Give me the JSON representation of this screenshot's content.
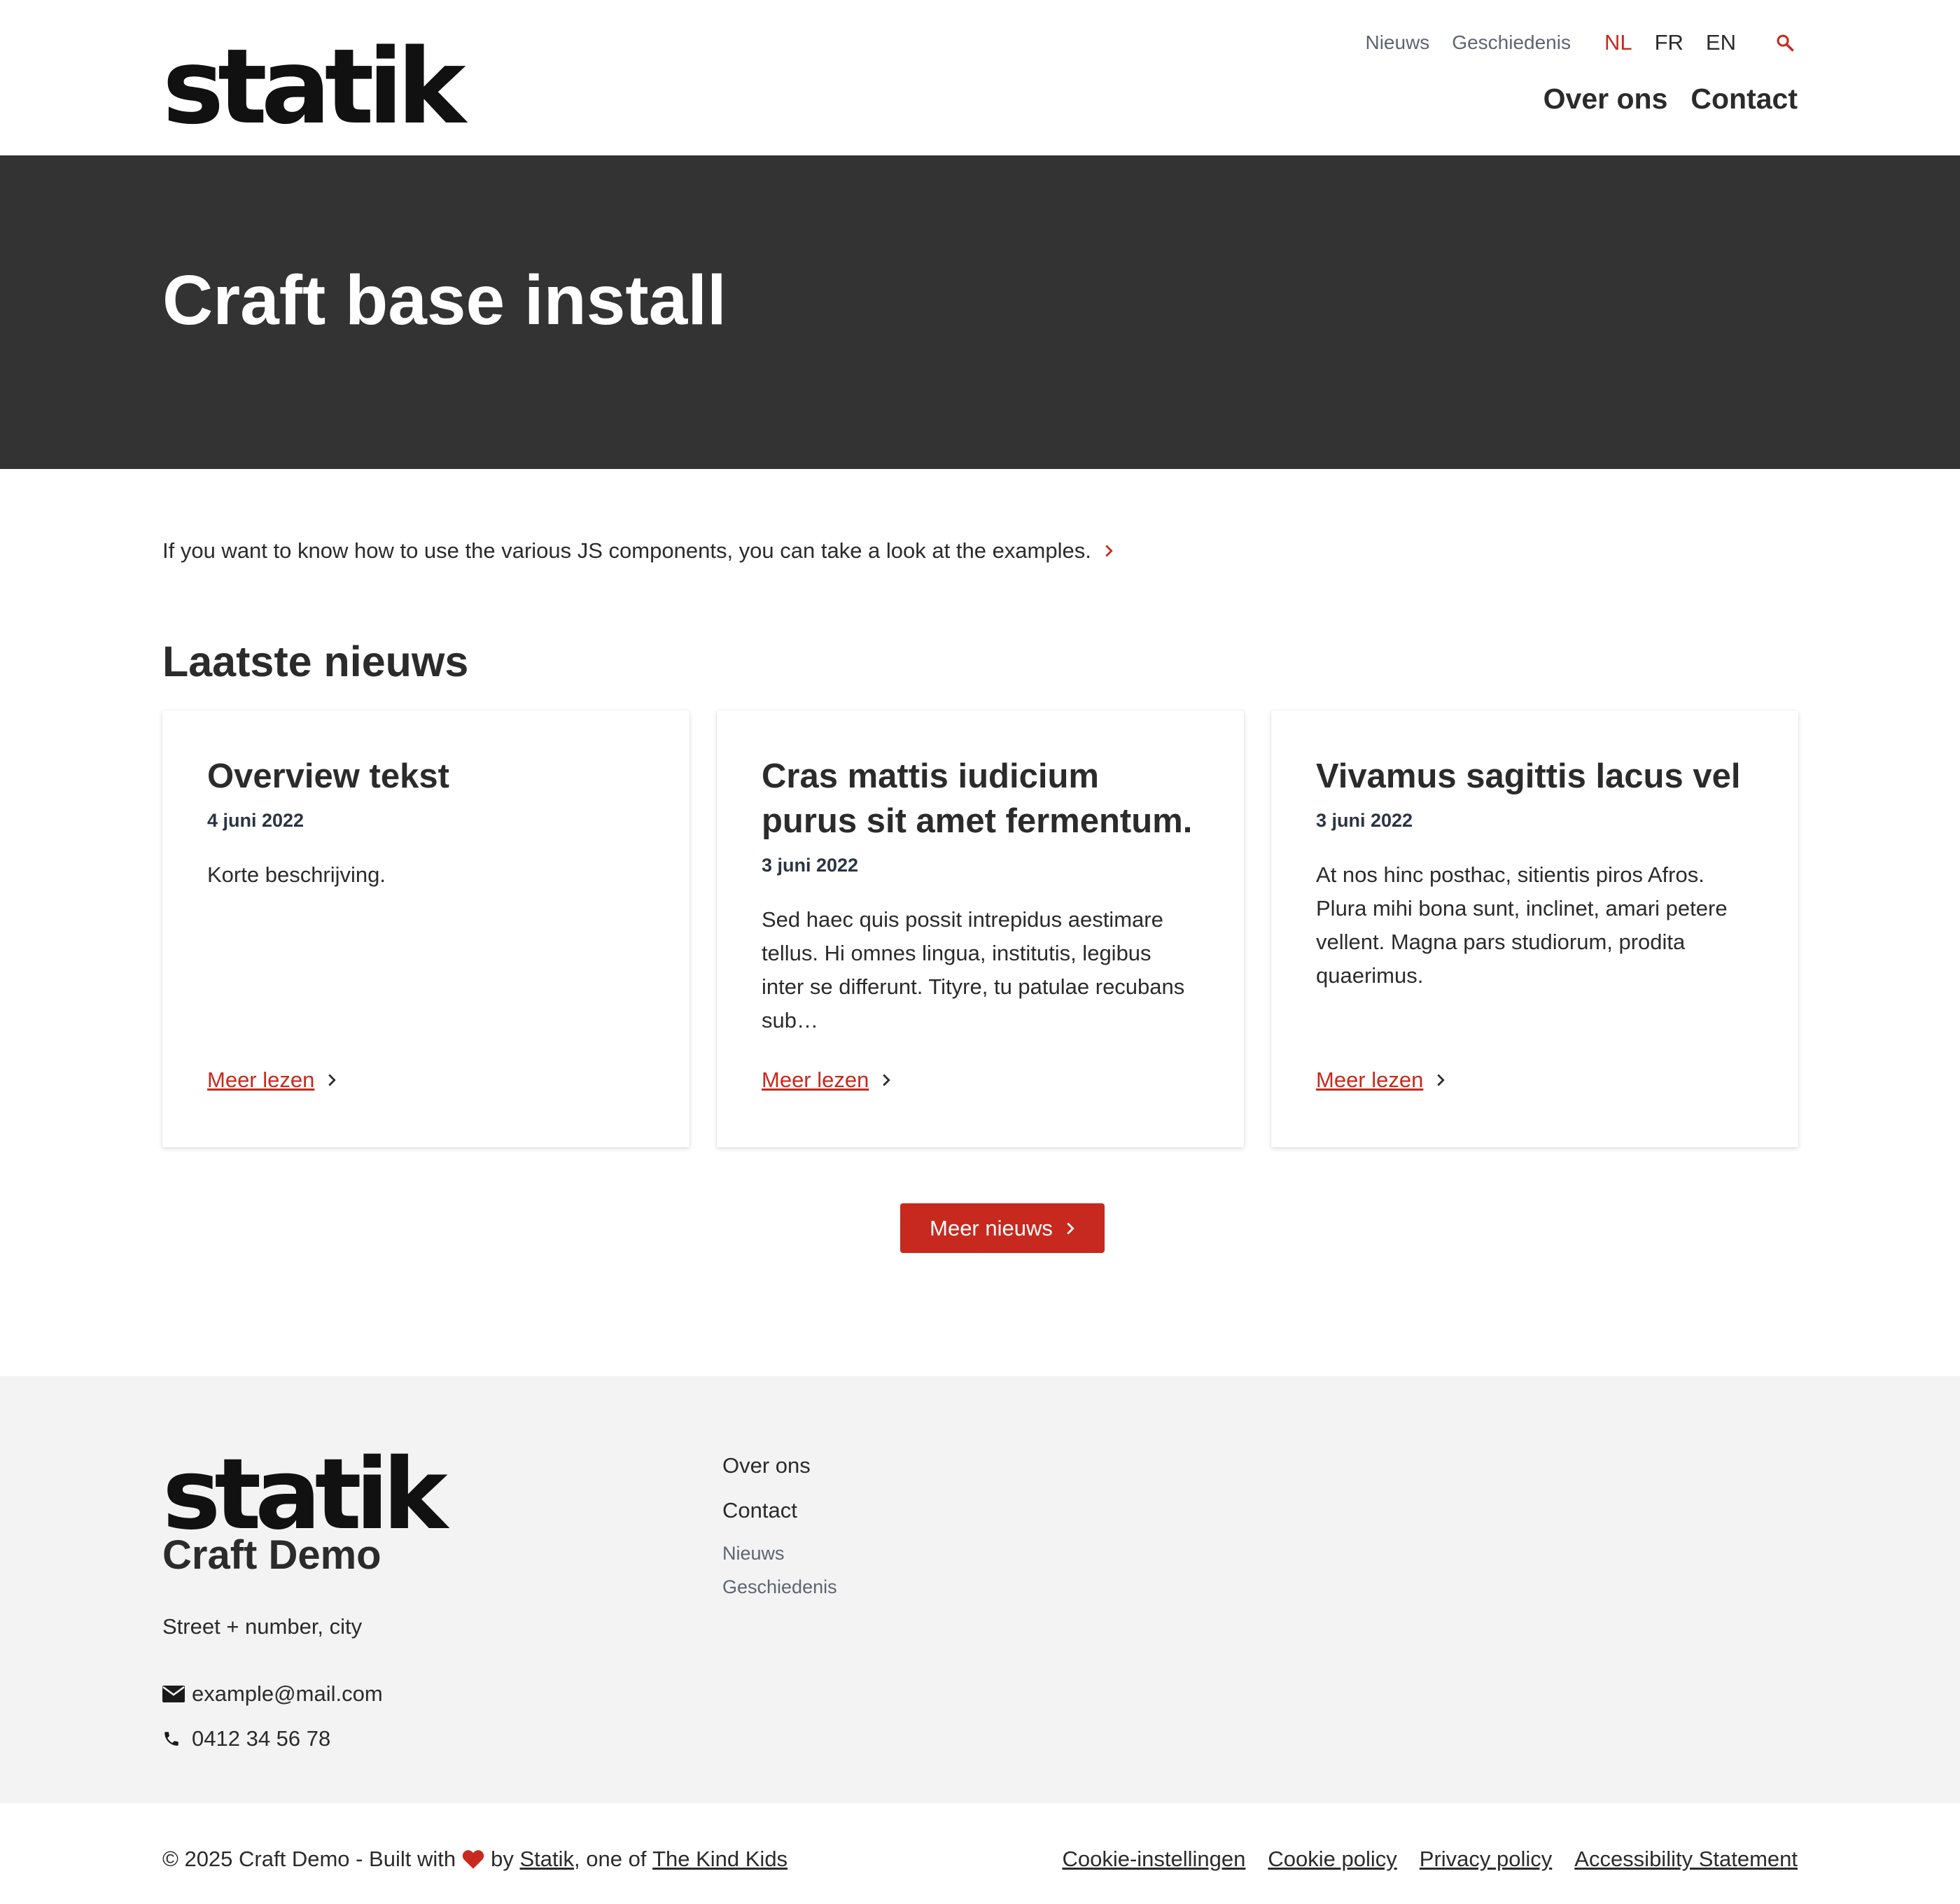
{
  "header": {
    "logo": "statik",
    "topnav": {
      "news": "Nieuws",
      "history": "Geschiedenis"
    },
    "languages": [
      "NL",
      "FR",
      "EN"
    ],
    "active_language": "NL",
    "search_icon": "search-icon",
    "mainnav": {
      "about": "Over ons",
      "contact": "Contact"
    }
  },
  "hero": {
    "title": "Craft base install"
  },
  "intro": {
    "text": "If you want to know how to use the various JS components, you can take a look at the examples.",
    "icon": "chevron-right-icon"
  },
  "news": {
    "title": "Laatste nieuws",
    "cards": [
      {
        "title": "Overview tekst",
        "date": "4 juni 2022",
        "description": "Korte beschrijving.",
        "link": "Meer lezen"
      },
      {
        "title": "Cras mattis iudicium purus sit amet fermentum.",
        "date": "3 juni 2022",
        "description": "Sed haec quis possit intrepidus aestimare tellus. Hi omnes lingua, institutis, legibus inter se differunt. Tityre, tu patulae recubans sub…",
        "link": "Meer lezen"
      },
      {
        "title": "Vivamus sagittis lacus vel",
        "date": "3 juni 2022",
        "description": "At nos hinc posthac, sitientis piros Afros. Plura mihi bona sunt, inclinet, amari petere vellent. Magna pars studiorum, prodita quaerimus.",
        "link": "Meer lezen"
      }
    ],
    "more_button": "Meer nieuws"
  },
  "footer": {
    "logo": "statik",
    "name": "Craft Demo",
    "address": "Street + number, city",
    "email": "example@mail.com",
    "phone": "0412 34 56 78",
    "nav": {
      "about": "Over ons",
      "contact": "Contact",
      "news": "Nieuws",
      "history": "Geschiedenis"
    }
  },
  "bottombar": {
    "copyright_prefix": "© 2025 Craft Demo - Built with",
    "by": "by",
    "statik_link": "Statik",
    "one_of": ", one of",
    "kind_kids_link": "The Kind Kids",
    "legal": [
      "Cookie-instellingen",
      "Cookie policy",
      "Privacy policy",
      "Accessibility Statement"
    ]
  },
  "colors": {
    "accent": "#c7291e",
    "hero_bg": "#333333",
    "footer_bg": "#f3f3f3",
    "text": "#2b2b2b",
    "muted": "#5f6470"
  }
}
